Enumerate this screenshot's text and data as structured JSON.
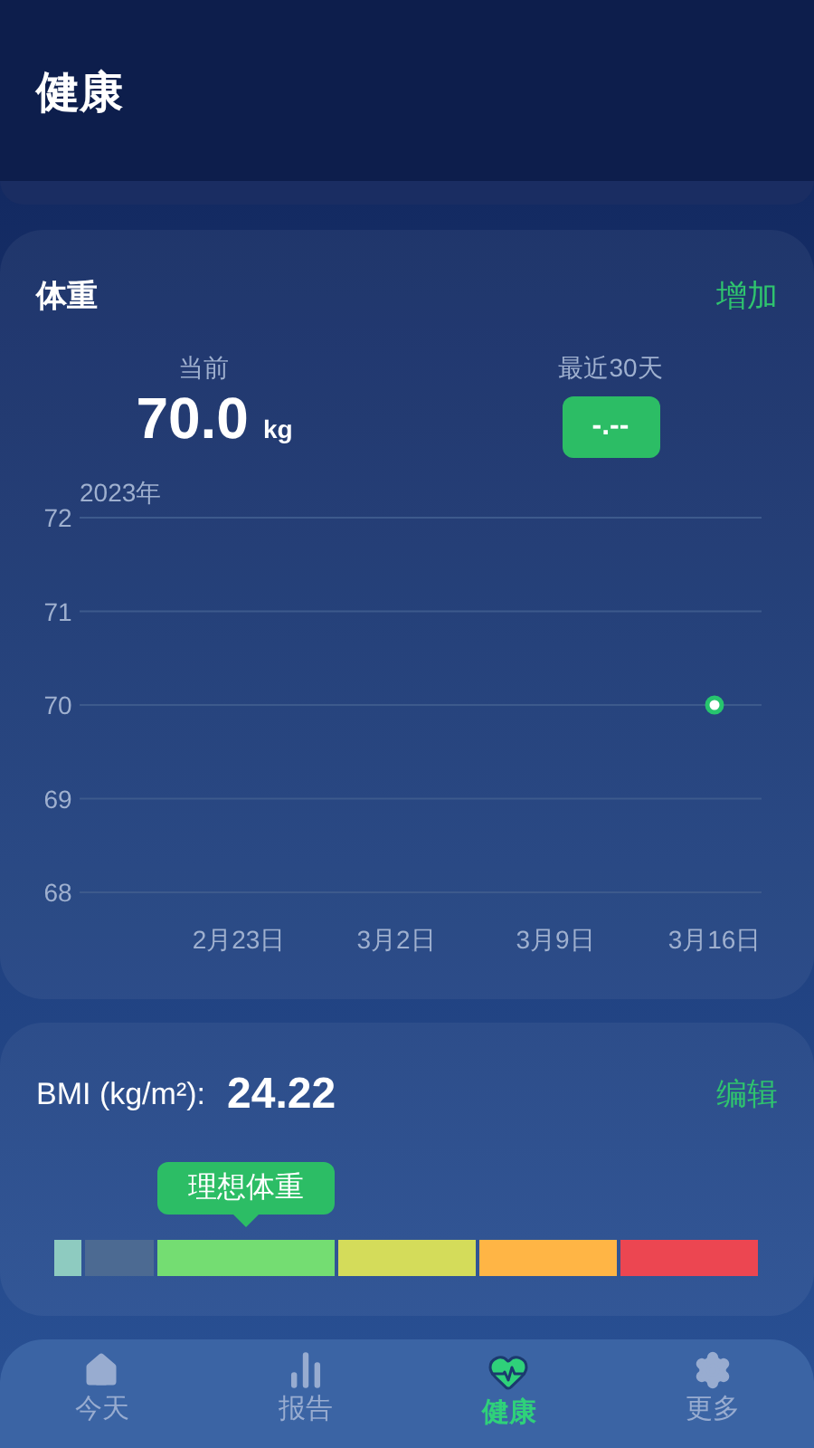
{
  "header": {
    "title": "健康"
  },
  "weight": {
    "title": "体重",
    "action": "增加",
    "current_label": "当前",
    "current_value": "70.0",
    "unit": "kg",
    "recent_label": "最近30天",
    "recent_value": "-.--",
    "year_label": "2023年",
    "chart_data": {
      "type": "line",
      "categories": [
        "2月23日",
        "3月2日",
        "3月9日",
        "3月16日"
      ],
      "series": [
        {
          "color": "#27c46e",
          "marker": true,
          "values": [
            null,
            null,
            null,
            70
          ]
        }
      ],
      "grid": true,
      "ylim": [
        68,
        72
      ],
      "yticks": [
        72,
        71,
        70,
        69,
        68
      ]
    }
  },
  "bmi": {
    "label": "BMI (kg/m²):",
    "value": "24.22",
    "action": "编辑",
    "marker": "理想体重",
    "segments": [
      {
        "color": "#8ecbc0",
        "selected": false
      },
      {
        "color": "#4c6a92",
        "selected": false
      },
      {
        "color": "#74dd72",
        "selected": true
      },
      {
        "color": "#d4dc5a",
        "selected": false
      },
      {
        "color": "#ffb545",
        "selected": false
      },
      {
        "color": "#ec4651",
        "selected": false
      }
    ]
  },
  "nav": [
    {
      "kind": "home",
      "label": "今天",
      "selected": false
    },
    {
      "kind": "report",
      "label": "报告",
      "selected": false
    },
    {
      "kind": "health",
      "label": "健康",
      "selected": true
    },
    {
      "kind": "more",
      "label": "更多",
      "selected": false
    }
  ]
}
